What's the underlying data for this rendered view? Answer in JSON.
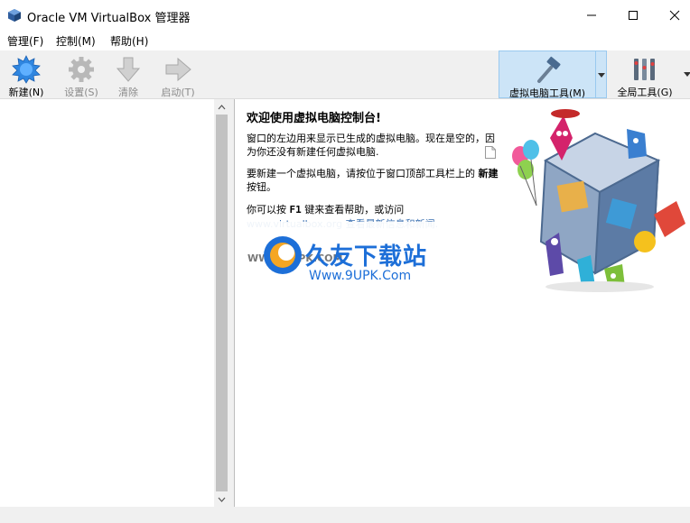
{
  "window": {
    "title": "Oracle VM VirtualBox 管理器",
    "app_icon": "virtualbox-cube-icon",
    "controls": [
      "minimize-icon",
      "maximize-icon",
      "close-icon"
    ]
  },
  "menu": {
    "items": [
      {
        "label": "管理(F)"
      },
      {
        "label": "控制(M)"
      },
      {
        "label": "帮助(H)"
      }
    ]
  },
  "toolbar": {
    "new_label": "新建(N)",
    "settings_label": "设置(S)",
    "discard_label": "清除",
    "start_label": "启动(T)",
    "machine_tools_label": "虚拟电脑工具(M)",
    "global_tools_label": "全局工具(G)",
    "accent": "#cce4f7"
  },
  "welcome": {
    "title": "欢迎使用虚拟电脑控制台!",
    "para1": "窗口的左边用来显示已生成的虚拟电脑。现在是空的，因为你还没有新建任何虚拟电脑.",
    "para2_prefix": "要新建一个虚拟电脑，请按位于窗口顶部工具栏上的 ",
    "para2_bold": "新建",
    "para2_suffix": " 按钮。",
    "para3_prefix": "你可以按 ",
    "para3_key": "F1",
    "para3_suffix": " 键来查看帮助，或访问",
    "para4": "www.virtualbox.org 查看最新信息和新闻."
  },
  "watermark": {
    "small_text": "WWW.9UPK.COM",
    "big_text": "久友下载站",
    "url_text": "Www.9UPK.Com"
  }
}
